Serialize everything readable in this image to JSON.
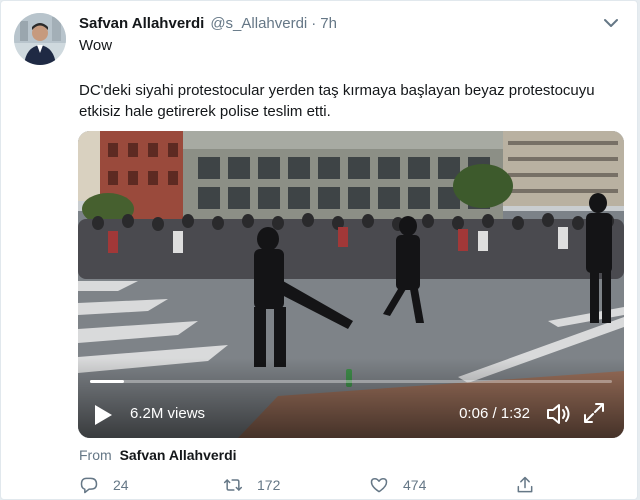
{
  "tweet": {
    "display_name": "Safvan Allahverdi",
    "handle": "@s_Allahverdi",
    "separator": "·",
    "time": "7h",
    "intro": "Wow",
    "text": "DC'deki siyahi protestocular yerden taş kırmaya başlayan beyaz protestocuyu etkisiz hale getirerek polise teslim etti."
  },
  "video": {
    "views": "6.2M views",
    "timecode": "0:06 / 1:32",
    "progress": 0.065
  },
  "attribution": {
    "prefix": "From",
    "name": "Safvan Allahverdi"
  },
  "actions": {
    "replies": "24",
    "retweets": "172",
    "likes": "474"
  },
  "icons": {
    "caret": "chevron-down-icon",
    "play": "play-icon",
    "volume": "volume-icon",
    "fullscreen": "fullscreen-icon",
    "reply": "reply-icon",
    "retweet": "retweet-icon",
    "like": "heart-icon",
    "share": "share-icon"
  },
  "colors": {
    "text": "#14171a",
    "secondary": "#657786",
    "border": "#e1e8ed"
  }
}
